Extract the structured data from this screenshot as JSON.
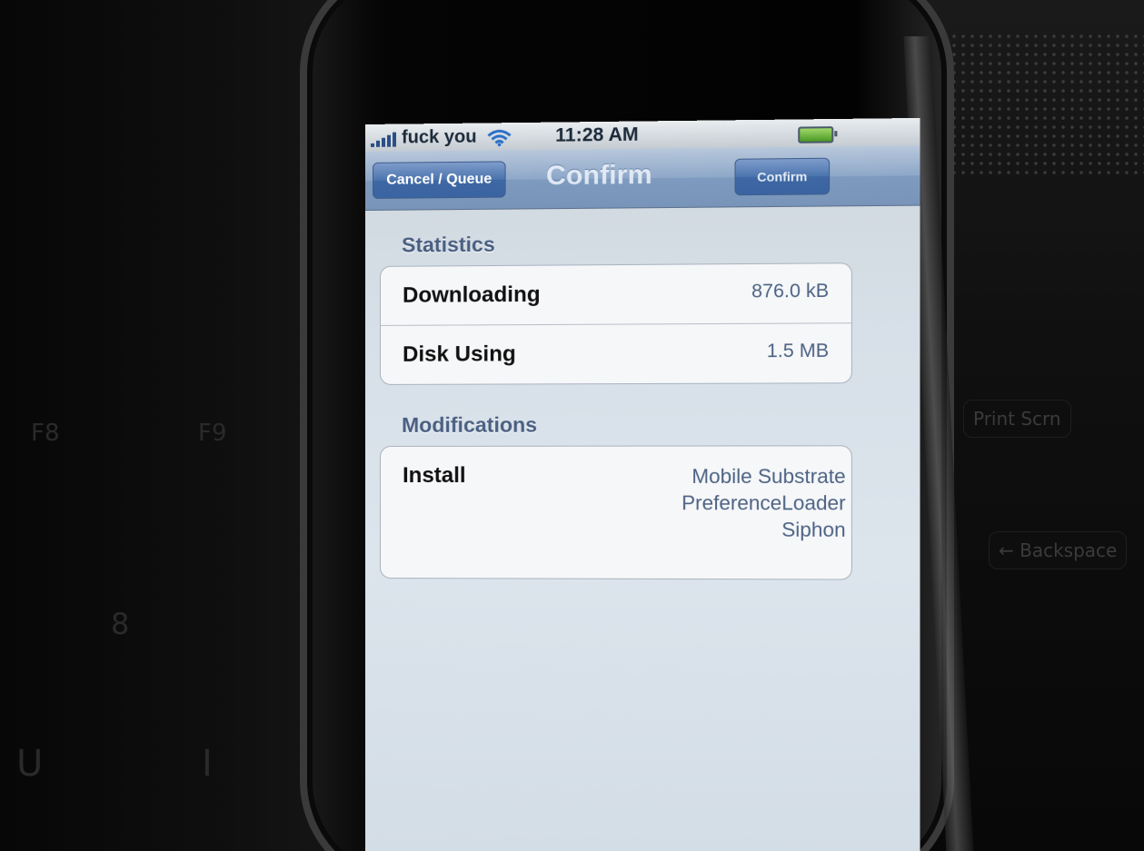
{
  "status_bar": {
    "carrier": "fuck you",
    "time": "11:28 AM"
  },
  "nav": {
    "left_button": "Cancel / Queue",
    "title": "Confirm",
    "right_button": "Confirm"
  },
  "statistics": {
    "header": "Statistics",
    "rows": [
      {
        "label": "Downloading",
        "value": "876.0 kB"
      },
      {
        "label": "Disk Using",
        "value": "1.5 MB"
      }
    ]
  },
  "modifications": {
    "header": "Modifications",
    "label": "Install",
    "packages": [
      "Mobile Substrate",
      "PreferenceLoader",
      "Siphon"
    ]
  },
  "background": {
    "keyboard_keys": [
      "F8",
      "F9",
      "8",
      "U",
      "I"
    ],
    "laptop_keys": [
      "Print Scrn",
      "← Backspace"
    ]
  },
  "icons": {
    "signal": "signal-bars-icon",
    "wifi": "wifi-icon",
    "battery": "battery-icon"
  },
  "colors": {
    "nav_button": "#3e67a3",
    "section_header": "#4a5f82",
    "value_text": "#4d6384"
  }
}
